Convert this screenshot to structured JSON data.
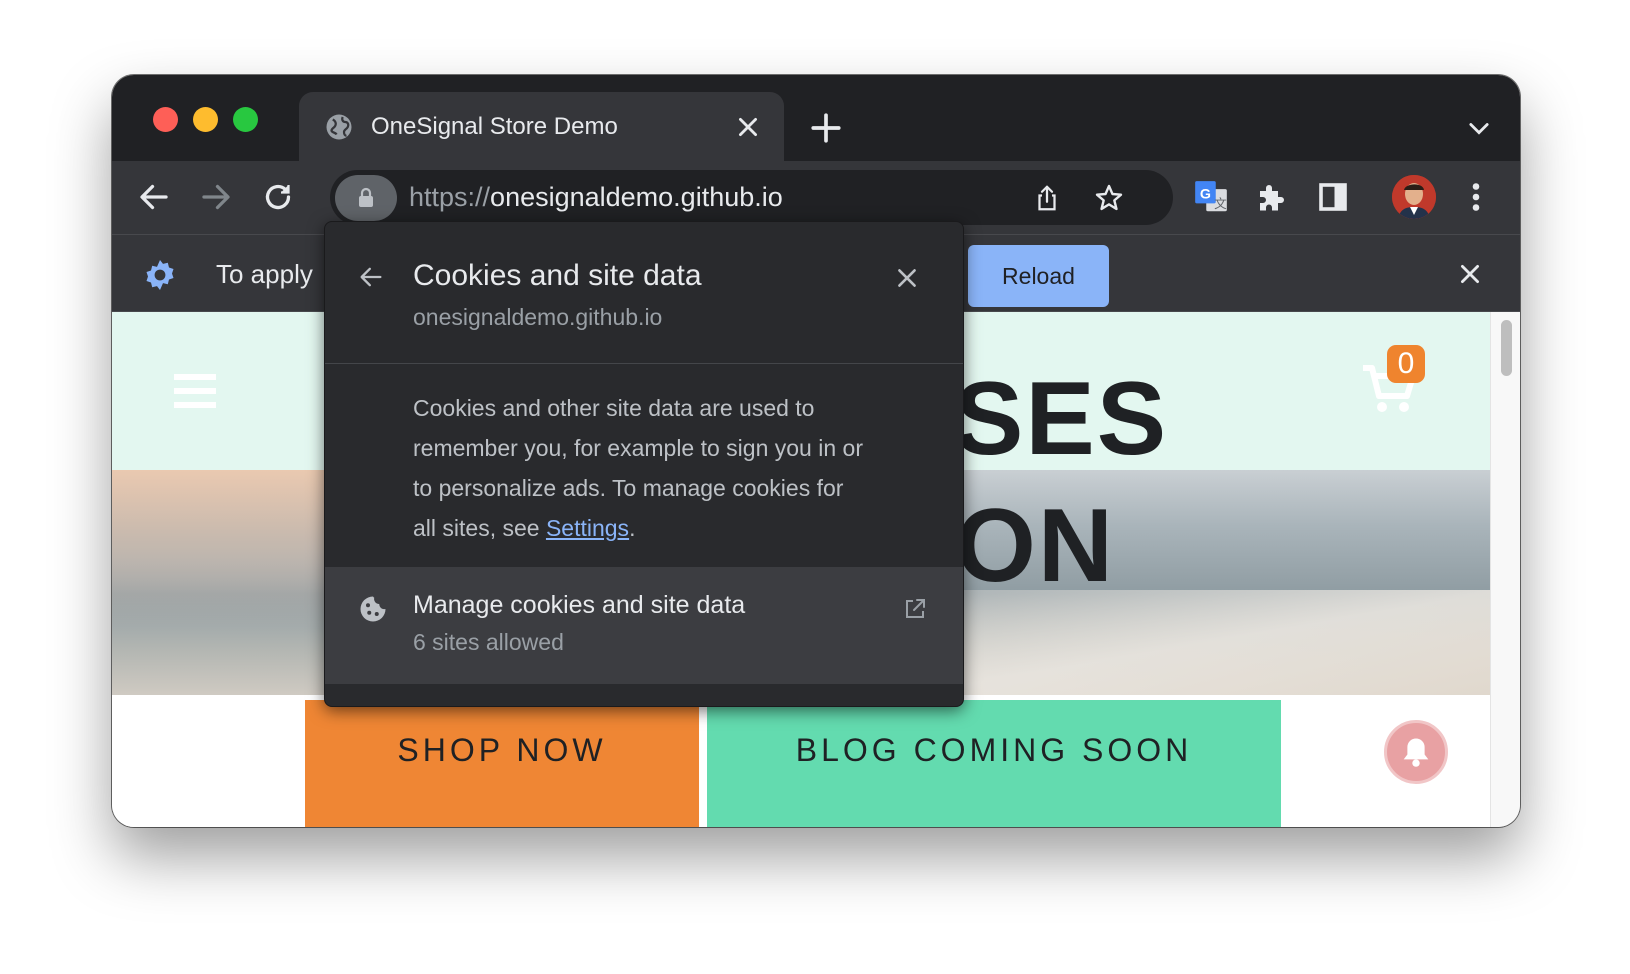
{
  "browser": {
    "tab_title": "OneSignal Store Demo",
    "url_scheme": "https://",
    "url_host": "onesignaldemo.github.io"
  },
  "infobar": {
    "text": "To apply",
    "reload_label": "Reload"
  },
  "page": {
    "hero_line1": "SES",
    "hero_line2": "ON",
    "cart_count": "0",
    "shop_button": "SHOP NOW",
    "blog_button": "BLOG COMING SOON"
  },
  "popup": {
    "title": "Cookies and site data",
    "site": "onesignaldemo.github.io",
    "desc_text": "Cookies and other site data are used to remember you, for example to sign you in or to personalize ads. To manage cookies for all sites, see ",
    "desc_link": "Settings",
    "desc_end": ".",
    "manage_title": "Manage cookies and site data",
    "manage_sub": "6 sites allowed"
  },
  "colors": {
    "titlebar": "#202124",
    "toolbar": "#35363a",
    "accent_link": "#8ab4f8",
    "shop_orange": "#ef8634",
    "blog_green": "#63dbaf",
    "hero_mint": "#e3f7f0"
  },
  "icons": [
    "globe-icon",
    "close-icon",
    "plus-icon",
    "chevron-down-icon",
    "back-arrow-icon",
    "forward-arrow-icon",
    "reload-icon",
    "lock-icon",
    "share-icon",
    "star-icon",
    "translate-icon",
    "puzzle-icon",
    "side-panel-icon",
    "kebab-menu-icon",
    "gear-icon",
    "hamburger-icon",
    "cart-icon",
    "bell-icon",
    "cookie-icon",
    "external-link-icon"
  ]
}
